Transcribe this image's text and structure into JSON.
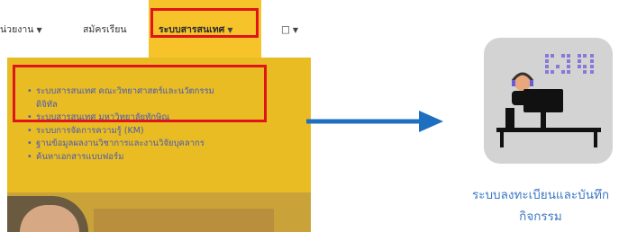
{
  "nav": {
    "items": [
      {
        "label": "น่วยงาน",
        "caret": "▼"
      },
      {
        "label": "สมัครเรียน",
        "caret": ""
      },
      {
        "label": "ระบบสารสนเทศ",
        "caret": "▼"
      },
      {
        "label": "□",
        "caret": "▼"
      }
    ]
  },
  "dropdown": {
    "items": [
      {
        "bullet": "•",
        "label": "ระบบสารสนเทศ คณะวิทยาศาสตร์และนวัตกรรม",
        "cont": "ดิจิทัล"
      },
      {
        "bullet": "•",
        "label": "ระบบสารสนเทศ มหาวิทยาลัยทักษิณ",
        "cont": ""
      },
      {
        "bullet": "•",
        "label": "ระบบการจัดการความรู้ (KM)",
        "cont": ""
      },
      {
        "bullet": "•",
        "label": "ฐานข้อมูลผลงานวิชาการและงานวิจัยบุคลากร",
        "cont": ""
      },
      {
        "bullet": "•",
        "label": "ค้นหาเอกสารแบบฟอร์ม",
        "cont": ""
      }
    ]
  },
  "app": {
    "caption_line1": "ระบบลงทะเบียนและบันทึก",
    "caption_line2": "กิจกรรม"
  },
  "colors": {
    "highlight_red": "#e0141b",
    "menu_yellow": "#f7c32a",
    "arrow_blue": "#1f6fc0",
    "caption_blue": "#3b78c4"
  },
  "icons": [
    "chevron-down-icon",
    "arrow-right-icon",
    "app-icon",
    "dotted-logo-icon",
    "person-at-computer-icon"
  ]
}
